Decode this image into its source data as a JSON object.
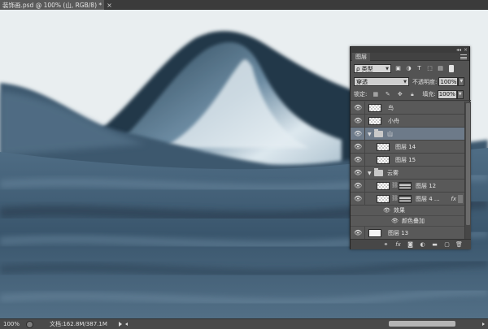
{
  "document_tab": {
    "title": "装饰画.psd @ 100% (山, RGB/8) *",
    "close": "×"
  },
  "canvas": {
    "colors": {
      "sky": "#e9eef0",
      "water_dark": "#2f4a60",
      "water_mid": "#4d6a82",
      "mountain_light": "#cfdde6"
    }
  },
  "status_bar": {
    "zoom": "100%",
    "doc_size": "文档:162.8M/387.1M"
  },
  "layers_panel": {
    "tab": "图层",
    "filter_kind": "ρ 类型",
    "filter_icons": [
      "image-filter-icon",
      "adjustment-filter-icon",
      "type-filter-icon",
      "shape-filter-icon",
      "smart-object-filter-icon"
    ],
    "blend_mode": "穿透",
    "opacity_label": "不透明度:",
    "opacity_value": "100%",
    "lock_label": "锁定:",
    "fill_label": "填充:",
    "fill_value": "100%",
    "layers": {
      "bird": "鸟",
      "boat": "小舟",
      "mountain_group": "山",
      "layer14": "图层 14",
      "layer15": "图层 15",
      "clouds_group": "云雾",
      "layer12": "图层 12",
      "layer4": "图层 4 ...",
      "effects": "效果",
      "color_overlay": "颜色叠加",
      "layer13": "图层 13"
    },
    "fx_label": "fx"
  }
}
